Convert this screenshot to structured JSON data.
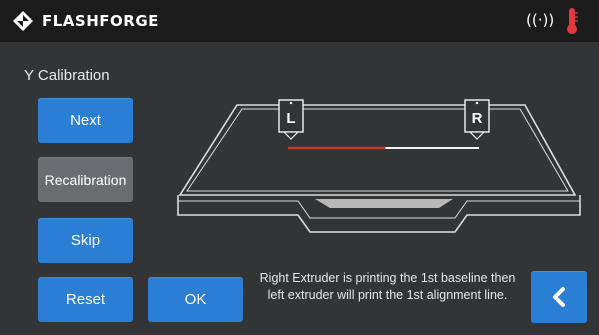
{
  "header": {
    "brand": "FLASHFORGE",
    "icons": [
      "flashforge-logo-icon",
      "wifi-icon",
      "thermometer-icon"
    ],
    "wifi_glyph": "((·))"
  },
  "page": {
    "title": "Y Calibration"
  },
  "buttons": {
    "next": "Next",
    "recalibration": "Recalibration",
    "skip": "Skip",
    "reset": "Reset",
    "ok": "OK",
    "back_icon": "chevron-left-icon"
  },
  "diagram": {
    "left_extruder_label": "L",
    "right_extruder_label": "R",
    "printed_line_fraction": 0.51
  },
  "instruction": "Right Extruder is printing the 1st baseline then left extruder will print the 1st alignment line.",
  "colors": {
    "primary_button": "#2a7ed3",
    "disabled_button": "#6b6c70",
    "background": "#333436",
    "topbar": "#1b1b1c",
    "printed_line": "#c0392b",
    "thermometer": "#e0393e"
  }
}
